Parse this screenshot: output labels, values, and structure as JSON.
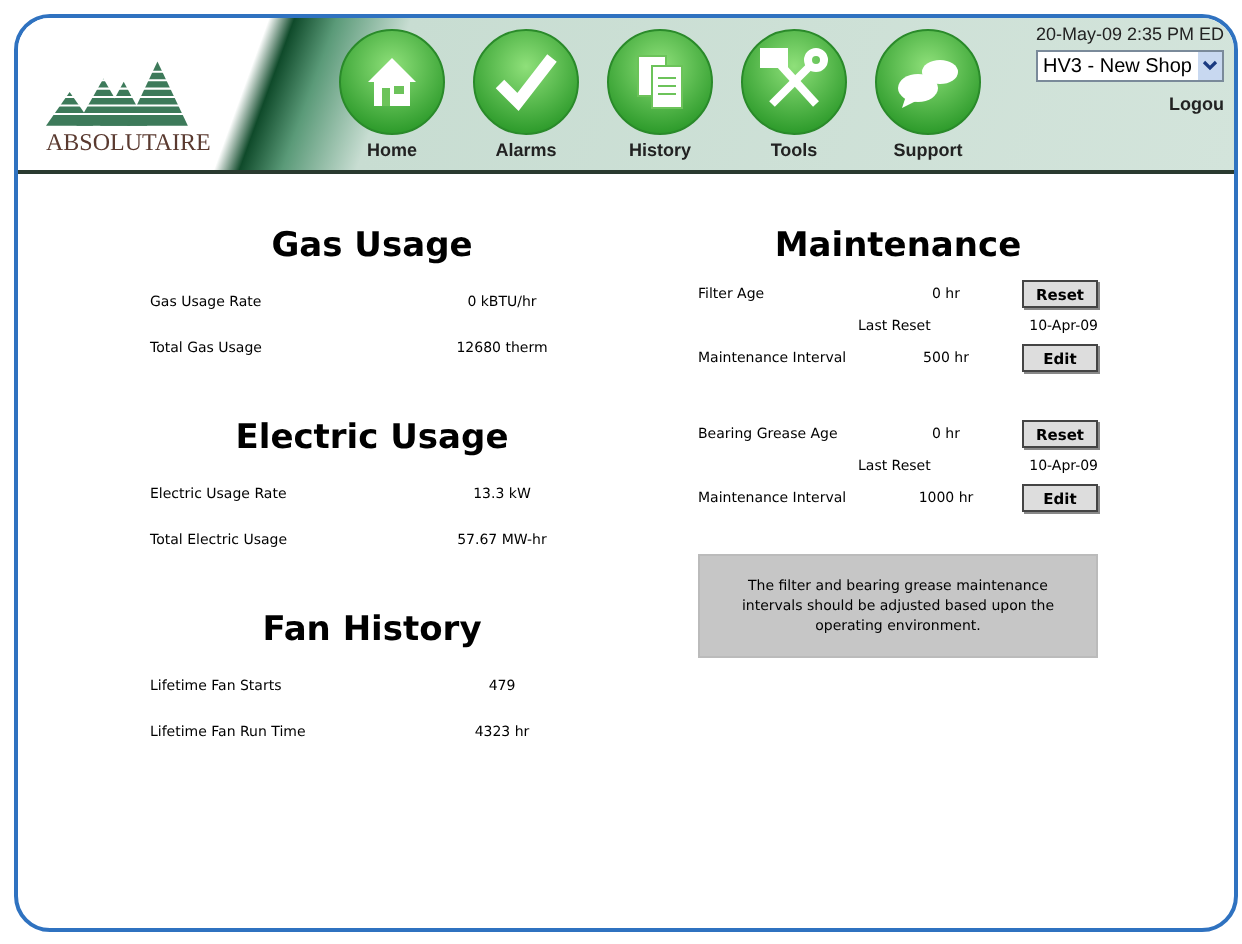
{
  "logo": {
    "text": "ABSOLUTAIRE"
  },
  "nav": [
    {
      "label": "Home",
      "kind": "home"
    },
    {
      "label": "Alarms",
      "kind": "check"
    },
    {
      "label": "History",
      "kind": "docs"
    },
    {
      "label": "Tools",
      "kind": "tools"
    },
    {
      "label": "Support",
      "kind": "chat"
    }
  ],
  "header_right": {
    "datetime": "20-May-09 2:35 PM ED",
    "site_select": "HV3 - New Shop",
    "logout": "Logou"
  },
  "sections": [
    {
      "title": "Gas Usage",
      "rows": [
        {
          "label": "Gas Usage Rate",
          "value": "0 kBTU/hr"
        },
        {
          "label": "Total Gas Usage",
          "value": "12680 therm"
        }
      ]
    },
    {
      "title": "Electric Usage",
      "rows": [
        {
          "label": "Electric Usage Rate",
          "value": "13.3 kW"
        },
        {
          "label": "Total Electric Usage",
          "value": "57.67 MW-hr"
        }
      ]
    },
    {
      "title": "Fan History",
      "rows": [
        {
          "label": "Lifetime Fan Starts",
          "value": "479"
        },
        {
          "label": "Lifetime Fan Run Time",
          "value": "4323 hr"
        }
      ]
    }
  ],
  "maintenance": {
    "title": "Maintenance",
    "groups": [
      {
        "rows": [
          {
            "kind": "value",
            "label": "Filter Age",
            "value": "0 hr",
            "button": "Reset"
          },
          {
            "kind": "last_reset",
            "label": "Last Reset",
            "value": "10-Apr-09"
          },
          {
            "kind": "value",
            "label": "Maintenance Interval",
            "value": "500 hr",
            "button": "Edit"
          }
        ]
      },
      {
        "rows": [
          {
            "kind": "value",
            "label": "Bearing Grease Age",
            "value": "0 hr",
            "button": "Reset"
          },
          {
            "kind": "last_reset",
            "label": "Last Reset",
            "value": "10-Apr-09"
          },
          {
            "kind": "value",
            "label": "Maintenance Interval",
            "value": "1000 hr",
            "button": "Edit"
          }
        ]
      }
    ],
    "note": "The filter and bearing grease maintenance intervals should be adjusted based upon the operating environment."
  }
}
